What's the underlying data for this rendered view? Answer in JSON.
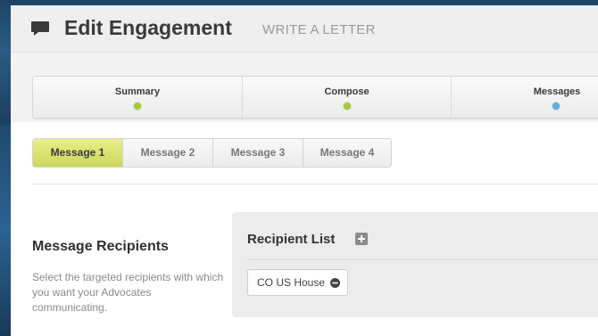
{
  "header": {
    "title": "Edit Engagement",
    "subtitle": "WRITE A LETTER",
    "icon": "comment-icon"
  },
  "steps": [
    {
      "label": "Summary",
      "status": "complete",
      "dot_color": "#a8c83a"
    },
    {
      "label": "Compose",
      "status": "complete",
      "dot_color": "#a8c83a"
    },
    {
      "label": "Messages",
      "status": "current",
      "dot_color": "#5ab0e0"
    }
  ],
  "message_tabs": [
    {
      "label": "Message 1",
      "active": true
    },
    {
      "label": "Message 2",
      "active": false
    },
    {
      "label": "Message 3",
      "active": false
    },
    {
      "label": "Message 4",
      "active": false
    }
  ],
  "recipients_section": {
    "heading": "Message Recipients",
    "description": "Select the targeted recipients with which you want your Advocates communicating."
  },
  "recipient_list": {
    "title": "Recipient List",
    "add_icon": "plus-square-icon",
    "chips": [
      {
        "label": "CO US House",
        "remove_icon": "minus-circle-icon"
      }
    ]
  },
  "colors": {
    "active_tab": "#d6e06e",
    "step_complete": "#a8c83a",
    "step_current": "#5ab0e0"
  }
}
